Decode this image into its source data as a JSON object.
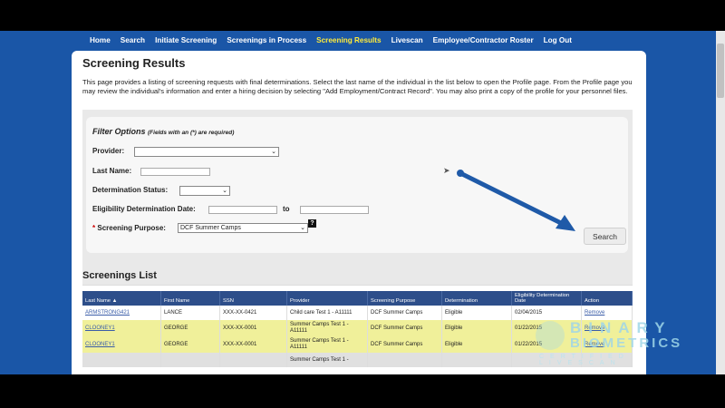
{
  "nav": {
    "items": [
      {
        "label": "Home",
        "active": false
      },
      {
        "label": "Search",
        "active": false
      },
      {
        "label": "Initiate Screening",
        "active": false
      },
      {
        "label": "Screenings in Process",
        "active": false
      },
      {
        "label": "Screening Results",
        "active": true
      },
      {
        "label": "Livescan",
        "active": false
      },
      {
        "label": "Employee/Contractor Roster",
        "active": false
      },
      {
        "label": "Log Out",
        "active": false
      }
    ]
  },
  "page": {
    "title": "Screening Results",
    "intro": "This page provides a listing of screening requests with final determinations. Select the last name of the individual in the list below to open the Profile page. From the Profile page you may review the individual's information and enter a hiring decision by selecting \"Add Employment/Contract Record\". You may also print a copy of the profile for your personnel files."
  },
  "filter": {
    "title": "Filter Options",
    "required_note": "(Fields with an (*) are required)",
    "provider_label": "Provider:",
    "provider_value": "",
    "last_name_label": "Last Name:",
    "last_name_value": "",
    "determination_label": "Determination Status:",
    "determination_value": "",
    "eligibility_label": "Eligibility Determination Date:",
    "to_label": "to",
    "required_star": "*",
    "purpose_label": "Screening Purpose:",
    "purpose_value": "DCF Summer Camps",
    "help_label": "?",
    "search_label": "Search"
  },
  "list": {
    "title": "Screenings List",
    "columns": [
      "Last Name ▲",
      "First Name",
      "SSN",
      "Provider",
      "Screening Purpose",
      "Determination",
      "Eligibility Determination Date",
      "Action"
    ],
    "rows": [
      {
        "last": "ARMSTRONG421",
        "first": "LANCE",
        "ssn": "XXX-XX-0421",
        "provider": "Child care Test 1 - A11111",
        "purpose": "DCF Summer Camps",
        "determination": "Eligible",
        "date": "02/04/2015",
        "action": "Remove",
        "style": "white"
      },
      {
        "last": "CLOONEY1",
        "first": "GEORGE",
        "ssn": "XXX-XX-0001",
        "provider": "Summer Camps Test 1 - A11111",
        "purpose": "DCF Summer Camps",
        "determination": "Eligible",
        "date": "01/22/2015",
        "action": "Remove",
        "style": "yellow"
      },
      {
        "last": "CLOONEY1",
        "first": "GEORGE",
        "ssn": "XXX-XX-0001",
        "provider": "Summer Camps Test 1 - A11111",
        "purpose": "DCF Summer Camps",
        "determination": "Eligible",
        "date": "01/22/2015",
        "action": "Remove",
        "style": "yellow"
      },
      {
        "last": "",
        "first": "",
        "ssn": "",
        "provider": "Summer Camps Test 1 -",
        "purpose": "",
        "determination": "",
        "date": "",
        "action": "",
        "style": "grey"
      }
    ]
  },
  "watermark": {
    "line1": "BINARY",
    "line2": "BIOMETRICS",
    "line3": "CERTIFIED LIVESCAN"
  },
  "colors": {
    "nav_bg": "#1a56a7",
    "nav_active": "#ffeb3b",
    "table_header": "#2d4e8a",
    "row_highlight": "#f0f09a",
    "arrow": "#1f5aa8"
  }
}
